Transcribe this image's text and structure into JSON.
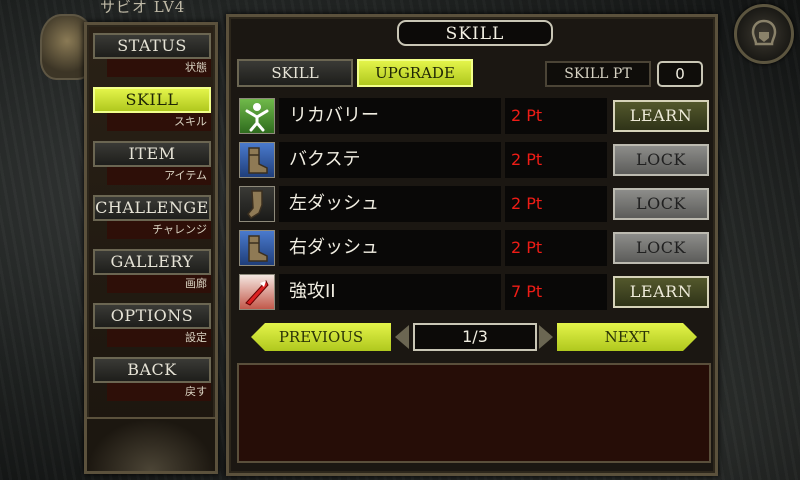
{
  "hero": {
    "name": "サビオ LV4",
    "portrait_icon": "hero-portrait-icon"
  },
  "menu_icon": "helmet-menu-icon",
  "nav": [
    {
      "label": "STATUS",
      "sub": "状態",
      "active": false
    },
    {
      "label": "SKILL",
      "sub": "スキル",
      "active": true
    },
    {
      "label": "ITEM",
      "sub": "アイテム",
      "active": false
    },
    {
      "label": "CHALLENGE",
      "sub": "チャレンジ",
      "active": false
    },
    {
      "label": "GALLERY",
      "sub": "画廊",
      "active": false
    },
    {
      "label": "OPTIONS",
      "sub": "設定",
      "active": false
    },
    {
      "label": "BACK",
      "sub": "戻す",
      "active": false
    }
  ],
  "panel": {
    "title": "SKILL",
    "tabs": {
      "skill": "SKILL",
      "upgrade": "UPGRADE",
      "active": "upgrade"
    },
    "skill_pt_label": "SKILL PT",
    "skill_pt_value": "0"
  },
  "skills": [
    {
      "name": "リカバリー",
      "cost": "2 Pt",
      "action": "LEARN",
      "icon": "recovery-icon"
    },
    {
      "name": "バクステ",
      "cost": "2 Pt",
      "action": "LOCK",
      "icon": "boot-icon"
    },
    {
      "name": "左ダッシュ",
      "cost": "2 Pt",
      "action": "LOCK",
      "icon": "boot-left-icon"
    },
    {
      "name": "右ダッシュ",
      "cost": "2 Pt",
      "action": "LOCK",
      "icon": "boot-right-icon"
    },
    {
      "name": "強攻II",
      "cost": "7 Pt",
      "action": "LEARN",
      "icon": "attack-icon"
    }
  ],
  "pager": {
    "previous": "PREVIOUS",
    "page": "1/3",
    "next": "NEXT"
  },
  "colors": {
    "accent": "#d4e83a",
    "cost": "#ee1c16",
    "frame": "#5b513c"
  }
}
